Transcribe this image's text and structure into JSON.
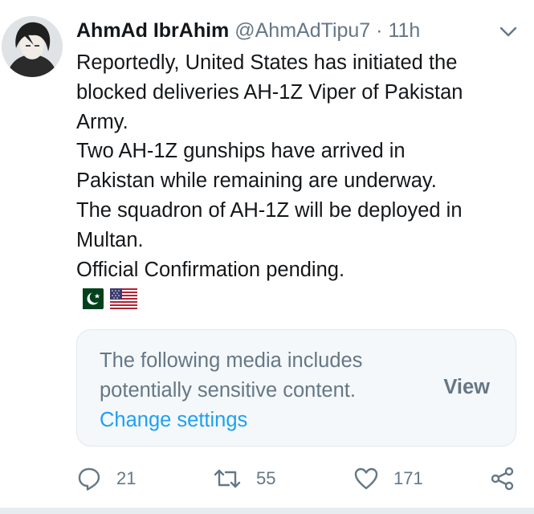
{
  "tweet": {
    "author": {
      "display_name": "AhmAd IbrAhim",
      "handle": "@AhmAdTipu7",
      "separator": "·",
      "time": "11h"
    },
    "text_lines": [
      "Reportedly, United States has initiated the",
      "blocked deliveries AH-1Z Viper of Pakistan",
      "Army.",
      "Two AH-1Z gunships have arrived in",
      "Pakistan while remaining are underway.",
      "The squadron of AH-1Z will be deployed in",
      "Multan.",
      "Official Confirmation pending."
    ],
    "flags": [
      "pakistan-flag",
      "usa-flag"
    ],
    "media_warning": {
      "line1": "The following media includes",
      "line2": "potentially sensitive content.",
      "change_settings": "Change settings",
      "view_label": "View"
    },
    "actions": {
      "replies": "21",
      "retweets": "55",
      "likes": "171"
    }
  },
  "colors": {
    "text": "#14171a",
    "secondary": "#657786",
    "link": "#1da1f2",
    "card_bg": "#f5f8fa",
    "card_border": "#e1e8ed"
  }
}
